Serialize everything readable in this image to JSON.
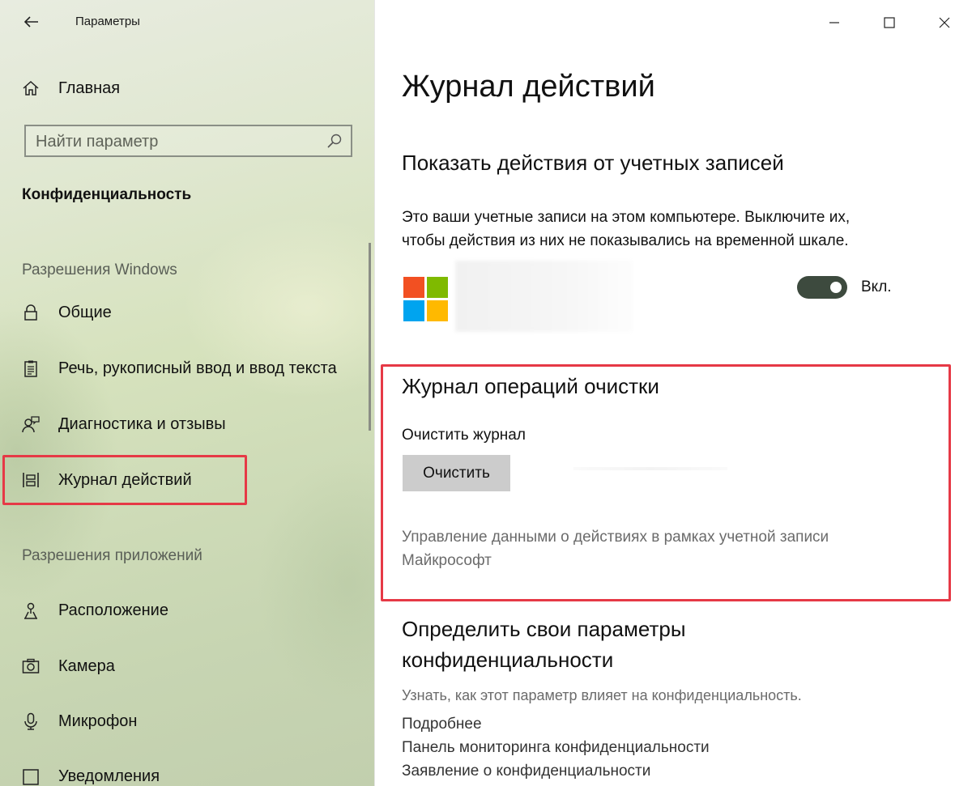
{
  "window": {
    "app_title": "Параметры"
  },
  "sidebar": {
    "home_label": "Главная",
    "search_placeholder": "Найти параметр",
    "category_title": "Конфиденциальность",
    "group_windows": "Разрешения Windows",
    "group_apps": "Разрешения приложений",
    "items": [
      {
        "label": "Общие",
        "icon": "lock-icon"
      },
      {
        "label": "Речь, рукописный ввод и ввод текста",
        "icon": "clipboard-icon"
      },
      {
        "label": "Диагностика и отзывы",
        "icon": "feedback-person-icon"
      },
      {
        "label": "Журнал действий",
        "icon": "timeline-icon",
        "selected": true
      },
      {
        "label": "Расположение",
        "icon": "location-person-icon"
      },
      {
        "label": "Камера",
        "icon": "camera-icon"
      },
      {
        "label": "Микрофон",
        "icon": "microphone-icon"
      },
      {
        "label": "Уведомления",
        "icon": "notification-icon"
      }
    ]
  },
  "main": {
    "page_title": "Журнал действий",
    "accounts_section": {
      "heading": "Показать действия от учетных записей",
      "description_line1": "Это ваши учетные записи на этом компьютере. Выключите их,",
      "description_line2": "чтобы действия из них не показывались на временной шкале.",
      "toggle_state": "Вкл.",
      "toggle_on": true
    },
    "clear_section": {
      "heading": "Журнал операций очистки",
      "subheading": "Очистить журнал",
      "button_label": "Очистить",
      "manage_link_line1": "Управление данными о действиях в рамках учетной записи",
      "manage_link_line2": "Майкрософт"
    },
    "privacy_section": {
      "heading_line1": "Определить свои параметры",
      "heading_line2": "конфиденциальности",
      "note": "Узнать, как этот параметр влияет на конфиденциальность.",
      "links": [
        "Подробнее",
        "Панель мониторинга конфиденциальности",
        "Заявление о конфиденциальности"
      ]
    }
  },
  "colors": {
    "highlight": "#e63946",
    "toggle_on": "#3d4a3e",
    "ms_red": "#f25022",
    "ms_green": "#7fba00",
    "ms_blue": "#00a4ef",
    "ms_yellow": "#ffb900"
  }
}
